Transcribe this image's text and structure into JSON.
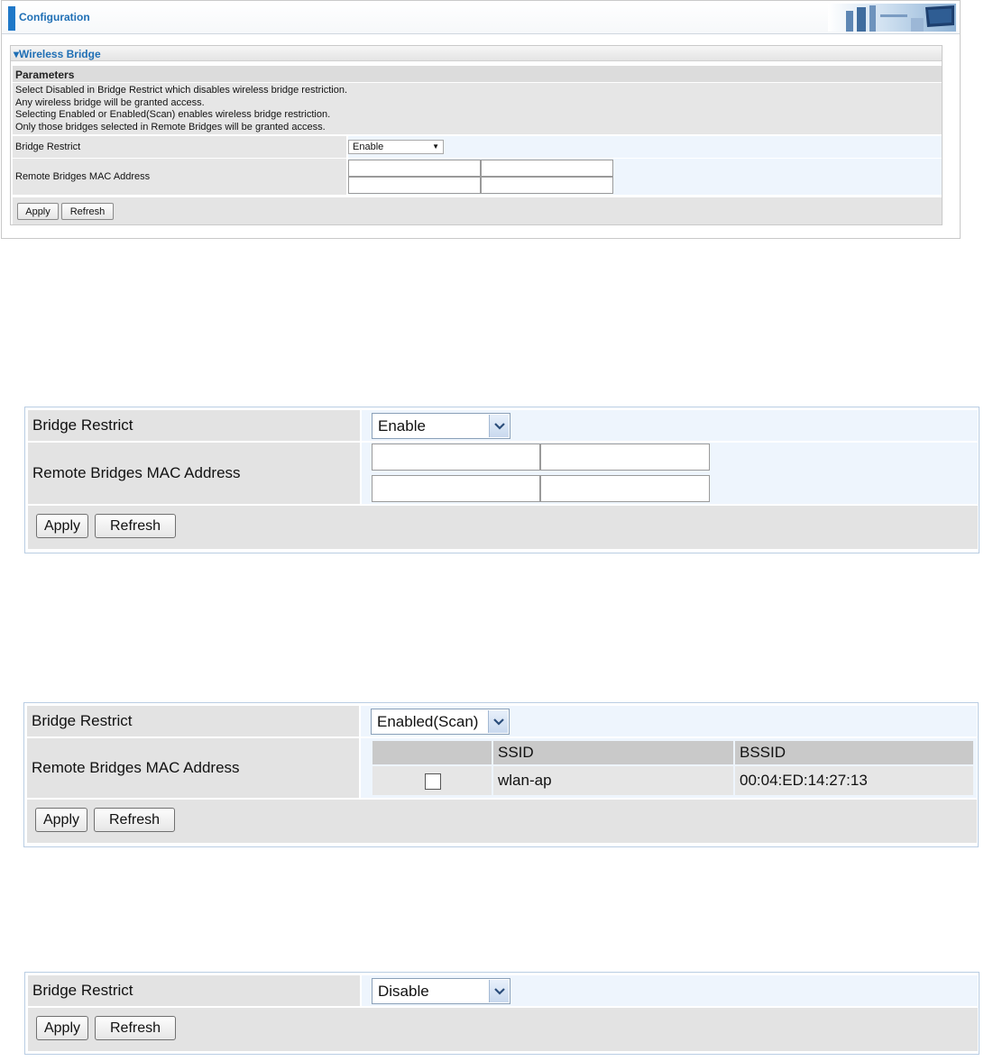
{
  "config_window": {
    "header_title": "Configuration",
    "section_title": "▾Wireless Bridge",
    "params_title": "Parameters",
    "description": [
      "Select Disabled in Bridge Restrict which disables wireless bridge restriction.",
      "Any wireless bridge will be granted access.",
      "Selecting Enabled or Enabled(Scan) enables wireless bridge restriction.",
      "Only those bridges selected in Remote Bridges will be granted access."
    ],
    "bridge_restrict_label": "Bridge Restrict",
    "bridge_restrict_value": "Enable",
    "remote_mac_label": "Remote Bridges MAC Address",
    "apply_label": "Apply",
    "refresh_label": "Refresh"
  },
  "enable_panel": {
    "bridge_restrict_label": "Bridge Restrict",
    "bridge_restrict_value": "Enable",
    "remote_mac_label": "Remote Bridges MAC Address",
    "apply_label": "Apply",
    "refresh_label": "Refresh"
  },
  "scan_panel": {
    "bridge_restrict_label": "Bridge Restrict",
    "bridge_restrict_value": "Enabled(Scan)",
    "remote_mac_label": "Remote Bridges MAC Address",
    "table": {
      "headers": [
        "",
        "SSID",
        "BSSID"
      ],
      "rows": [
        {
          "checked": false,
          "ssid": "wlan-ap",
          "bssid": "00:04:ED:14:27:13"
        }
      ]
    },
    "apply_label": "Apply",
    "refresh_label": "Refresh"
  },
  "disable_panel": {
    "bridge_restrict_label": "Bridge Restrict",
    "bridge_restrict_value": "Disable",
    "apply_label": "Apply",
    "refresh_label": "Refresh"
  },
  "colors": {
    "accent_blue": "#1f6fb5",
    "label_bg": "#e3e3e3",
    "value_bg": "#eef5fd"
  }
}
